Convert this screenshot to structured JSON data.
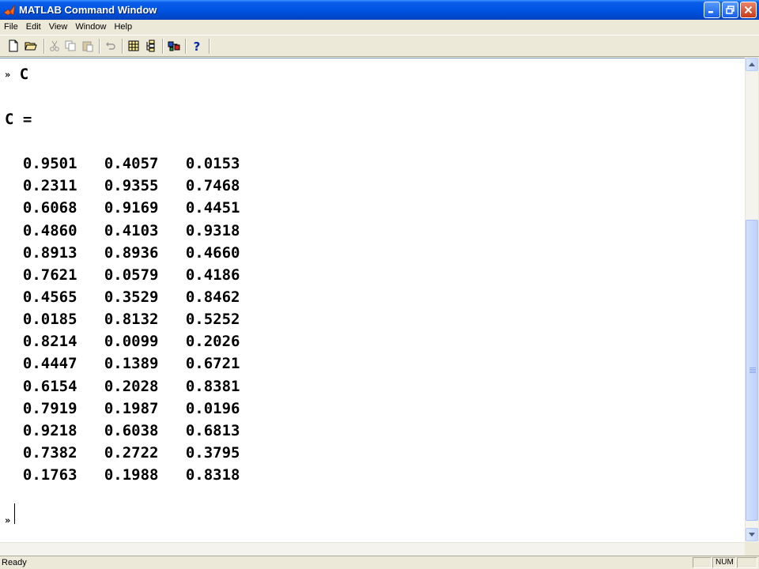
{
  "window": {
    "title": "MATLAB Command Window",
    "titlebar_color": "#0054e3"
  },
  "menu": [
    "File",
    "Edit",
    "View",
    "Window",
    "Help"
  ],
  "toolbar": {
    "buttons": [
      {
        "name": "new-file-icon"
      },
      {
        "name": "open-folder-icon"
      },
      {
        "name": "cut-icon"
      },
      {
        "name": "copy-icon"
      },
      {
        "name": "paste-icon"
      },
      {
        "name": "undo-icon"
      },
      {
        "name": "workspace-browser-icon"
      },
      {
        "name": "path-browser-icon"
      },
      {
        "name": "simulink-icon"
      },
      {
        "name": "help-icon"
      }
    ]
  },
  "console": {
    "prompt_symbol": "»",
    "command": "C",
    "result_label": "C =",
    "matrix": [
      [
        "0.9501",
        "0.4057",
        "0.0153"
      ],
      [
        "0.2311",
        "0.9355",
        "0.7468"
      ],
      [
        "0.6068",
        "0.9169",
        "0.4451"
      ],
      [
        "0.4860",
        "0.4103",
        "0.9318"
      ],
      [
        "0.8913",
        "0.8936",
        "0.4660"
      ],
      [
        "0.7621",
        "0.0579",
        "0.4186"
      ],
      [
        "0.4565",
        "0.3529",
        "0.8462"
      ],
      [
        "0.0185",
        "0.8132",
        "0.5252"
      ],
      [
        "0.8214",
        "0.0099",
        "0.2026"
      ],
      [
        "0.4447",
        "0.1389",
        "0.6721"
      ],
      [
        "0.6154",
        "0.2028",
        "0.8381"
      ],
      [
        "0.7919",
        "0.1987",
        "0.0196"
      ],
      [
        "0.9218",
        "0.6038",
        "0.6813"
      ],
      [
        "0.7382",
        "0.2722",
        "0.3795"
      ],
      [
        "0.1763",
        "0.1988",
        "0.8318"
      ]
    ]
  },
  "status": {
    "text": "Ready",
    "num_indicator": "NUM"
  }
}
